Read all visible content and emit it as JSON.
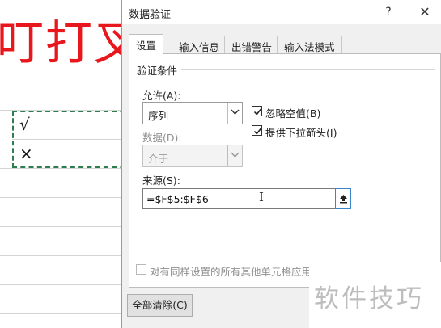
{
  "sheet": {
    "big_title": "叮打叉",
    "cells": [
      "√",
      "×"
    ],
    "border_color": "#2e7d4f",
    "title_color": "#e8161d"
  },
  "dialog": {
    "title": "数据验证",
    "help_label": "?",
    "close_label": "✕",
    "tabs": [
      {
        "label": "设置",
        "active": true
      },
      {
        "label": "输入信息",
        "active": false
      },
      {
        "label": "出错警告",
        "active": false
      },
      {
        "label": "输入法模式",
        "active": false
      }
    ],
    "group_label": "验证条件",
    "allow": {
      "label": "允许(A):",
      "value": "序列"
    },
    "data": {
      "label": "数据(D):",
      "value": "介于"
    },
    "ignore_blank": {
      "label": "忽略空值(B)",
      "checked": true
    },
    "dropdown_arrow": {
      "label": "提供下拉箭头(I)",
      "checked": true
    },
    "source": {
      "label": "来源(S):",
      "value": "=$F$5:$F$6"
    },
    "apply_all": {
      "label": "对有同样设置的所有其他单元格应用这些更改(P)",
      "checked": false
    },
    "clear_all_label": "全部清除(C)"
  },
  "watermark": {
    "text": "软件技巧"
  },
  "icons": {
    "dropdown": "chevron-down-icon",
    "collapse": "collapse-dialog-icon",
    "cursor": "ibeam-cursor-icon"
  }
}
